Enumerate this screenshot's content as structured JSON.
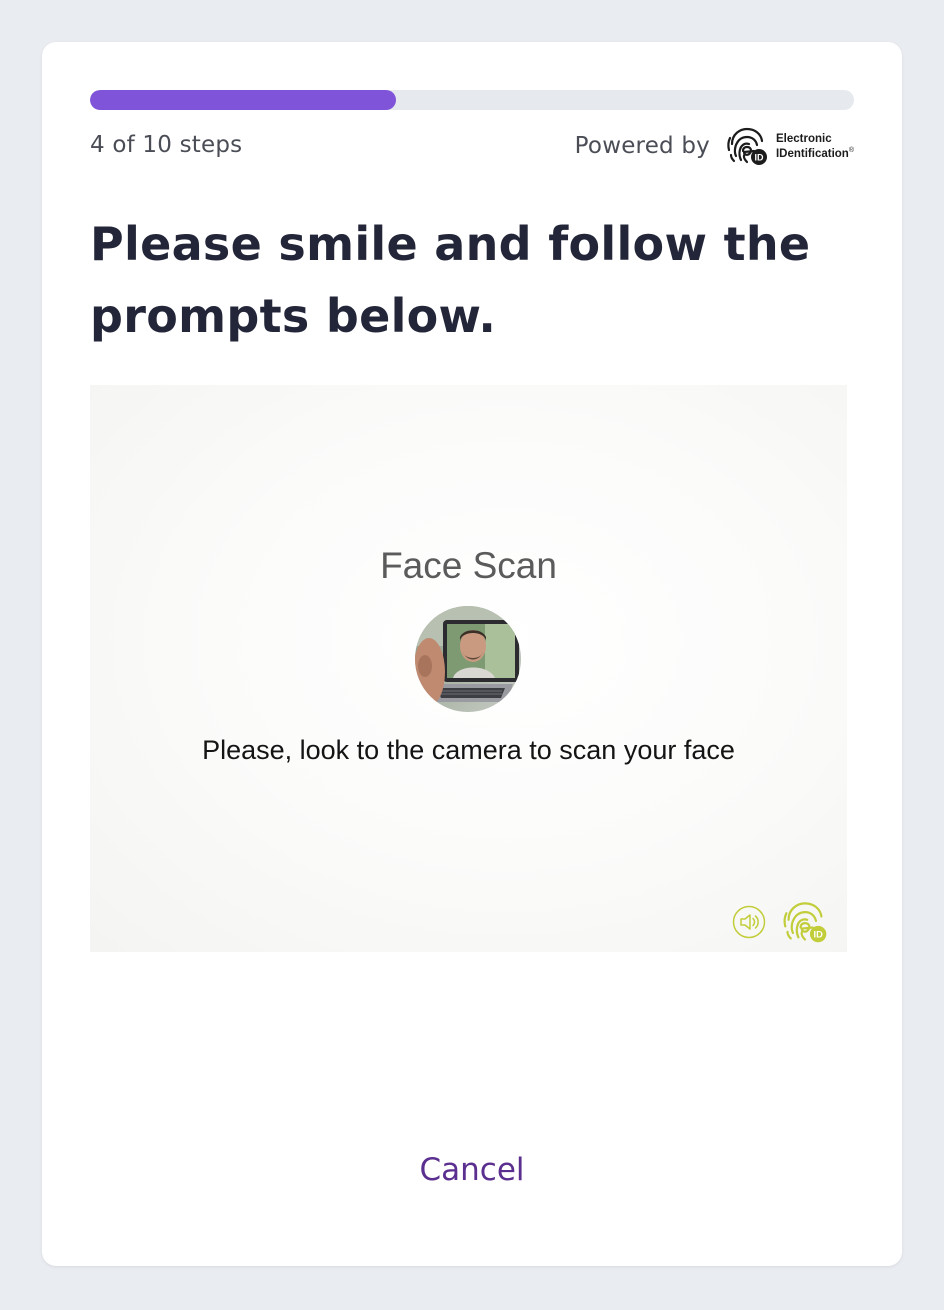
{
  "progress": {
    "fraction": 0.4,
    "steps_label": "4 of 10 steps",
    "fill_color": "#7f54d9",
    "track_color": "#e6eaee"
  },
  "powered": {
    "label": "Powered by",
    "logo_line1": "Electronic",
    "logo_line2": "IDentification",
    "logo_mark": "®"
  },
  "title": "Please smile and follow the prompts below.",
  "scan": {
    "title": "Face Scan",
    "instruction": "Please, look to the camera to scan your face",
    "sound_icon": "speaker-icon",
    "brand_icon": "fingerprint-eid-icon",
    "accent_color": "#c2cd3a"
  },
  "actions": {
    "cancel_label": "Cancel",
    "cancel_color": "#5b2f8f"
  }
}
